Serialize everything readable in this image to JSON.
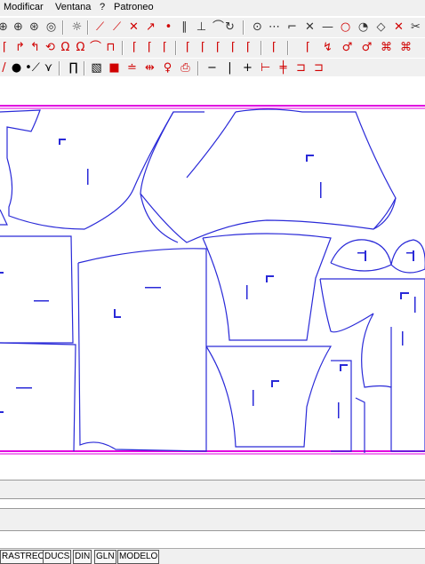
{
  "menu": {
    "items": [
      "Modificar",
      "Ventana",
      "?",
      "Patroneo"
    ]
  },
  "toolbar1": {
    "icons": [
      "zoom-in-icon",
      "zoom-window-icon",
      "zoom-all-icon",
      "zoom-prev-icon",
      "hand-icon",
      "line-icon",
      "polyline-icon",
      "cross-icon",
      "arrow-line-icon",
      "point-icon",
      "parallel-icon",
      "perpendicular-icon",
      "curve-icon",
      "circle-point-icon",
      "dotted-line-icon",
      "corner-icon",
      "cross-line-icon",
      "dash-line-icon",
      "circle-icon",
      "rotate-icon",
      "erase-icon",
      "delete-red-icon",
      "scissors-icon"
    ]
  },
  "toolbar2": {
    "icons": [
      "piece-1-icon",
      "piece-2-icon",
      "piece-3-icon",
      "piece-4-icon",
      "piece-5-icon",
      "piece-6-icon",
      "piece-7-icon",
      "piece-8-icon",
      "piece-9-icon",
      "piece-10-icon",
      "piece-11-icon",
      "piece-12-icon",
      "piece-13-icon",
      "piece-14-icon",
      "piece-15-icon",
      "piece-16-icon",
      "piece-17-icon",
      "piece-18-icon",
      "piece-19-icon",
      "piece-20-icon"
    ]
  },
  "toolbar3": {
    "icons": [
      "red-dot-icon",
      "black-dot-icon",
      "dot-line-icon",
      "notch-icon",
      "box-icon",
      "hatch-icon",
      "red-square-icon",
      "stack-icon",
      "arrows-icon",
      "person-icon",
      "printer-icon",
      "minus-icon",
      "vline-icon",
      "plus-icon",
      "mark-icon",
      "red-plus-icon",
      "red-box-icon",
      "red-box2-icon"
    ]
  },
  "tabs": [
    "RASTREO",
    "DUCS",
    "DIN",
    "GLN",
    "MODELO"
  ],
  "colors": {
    "pattern_line": "#2a2ad8",
    "border_magenta": "#e000e0",
    "toolbar_bg": "#f0f0f0"
  }
}
